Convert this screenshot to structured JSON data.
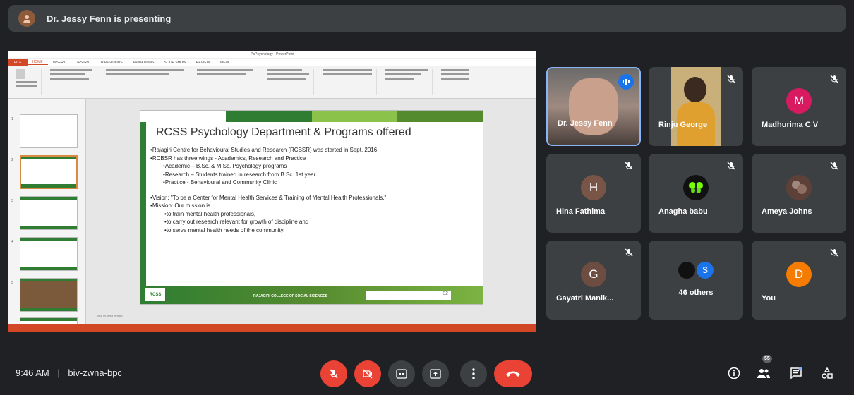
{
  "presenter_bar": {
    "text": "Dr. Jessy Fenn is presenting"
  },
  "ppt": {
    "window_title": "PsPsychology - PowerPoint",
    "tabs": [
      "FILE",
      "HOME",
      "INSERT",
      "DESIGN",
      "TRANSITIONS",
      "ANIMATIONS",
      "SLIDE SHOW",
      "REVIEW",
      "VIEW"
    ],
    "notes_placeholder": "Click to add notes"
  },
  "slide": {
    "title": "RCSS Psychology Department & Programs offered",
    "lines": [
      "Rajagiri Centre for Behavioural Studies and Research (RCBSR) was started in Sept. 2016.",
      "RCBSR  has three wings - Academics, Research and Practice",
      "Academic – B.Sc. & M.Sc. Psychology programs",
      "Research – Students trained in research from B.Sc. 1st year",
      "Practice -  Behavioural and Community Clinic",
      "Vision: \"To be a Center for Mental Health Services & Training of Mental Health Professionals.\"",
      "Mission: Our mission is ...",
      "to train mental health professionals,",
      "to carry out research relevant for growth of discipline and",
      "to serve mental health needs of the community."
    ],
    "logo_text": "RCSS",
    "footer_text": "RAJAGIRI COLLEGE OF SOCIAL SCIENCES",
    "slide_number": "02"
  },
  "participants": [
    {
      "name": "Dr. Jessy Fenn",
      "type": "video"
    },
    {
      "name": "Rinju George",
      "type": "video"
    },
    {
      "name": "Madhurima C V",
      "initial": "M",
      "color": "#d81b60"
    },
    {
      "name": "Hina Fathima",
      "initial": "H",
      "color": "#795548"
    },
    {
      "name": "Anagha babu",
      "initial": "",
      "color": "#111111"
    },
    {
      "name": "Ameya Johns",
      "initial": "",
      "color": "#6d4c41"
    },
    {
      "name": "Gayatri Manik...",
      "initial": "G",
      "color": "#6d4c41"
    },
    {
      "name": "46 others",
      "initial": "S",
      "color": "#1a73e8"
    },
    {
      "name": "You",
      "initial": "D",
      "color": "#f57c00"
    }
  ],
  "bottom": {
    "time": "9:46 AM",
    "separator": "|",
    "meeting_code": "biv-zwna-bpc",
    "participant_count": "55"
  }
}
